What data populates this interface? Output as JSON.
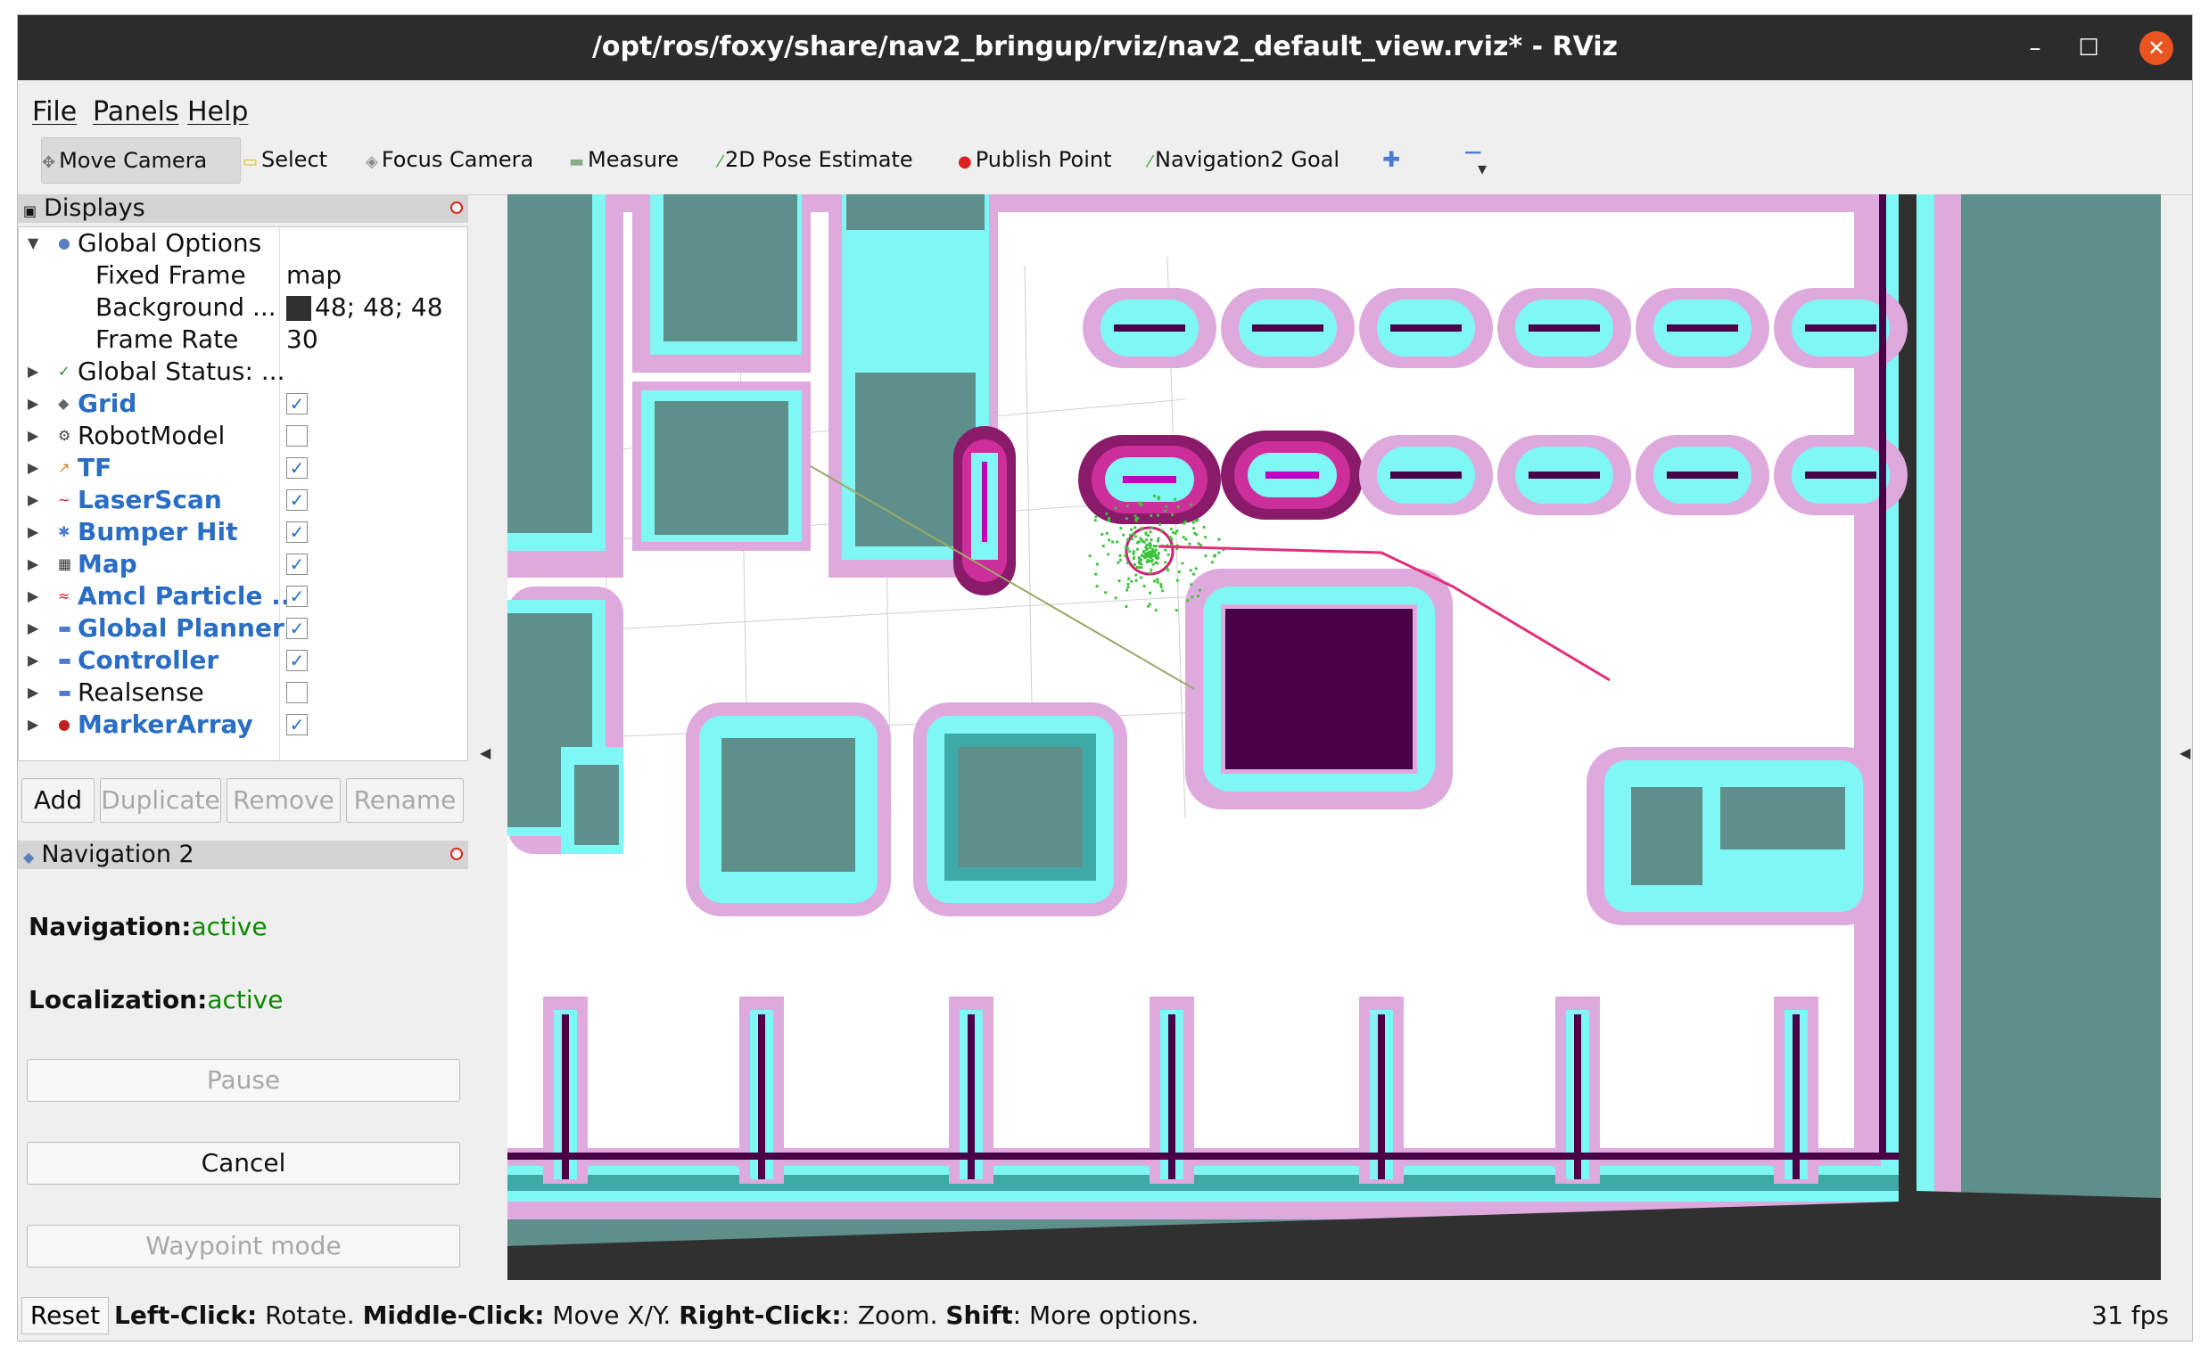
{
  "window": {
    "title": "/opt/ros/foxy/share/nav2_bringup/rviz/nav2_default_view.rviz* - RViz",
    "minimize_glyph": "–",
    "maximize_glyph": "☐",
    "close_glyph": "✕"
  },
  "menubar": {
    "file": "File",
    "panels": "Panels",
    "help": "Help"
  },
  "toolbar": {
    "move_camera": "Move Camera",
    "select": "Select",
    "focus_camera": "Focus Camera",
    "measure": "Measure",
    "pose_estimate": "2D Pose Estimate",
    "publish_point": "Publish Point",
    "nav_goal": "Navigation2 Goal",
    "add_glyph": "✚",
    "remove_glyph": "−",
    "dropdown_glyph": "▾"
  },
  "displays": {
    "header": "Displays",
    "global_options": "Global Options",
    "fixed_frame_label": "Fixed Frame",
    "fixed_frame_value": "map",
    "background_label": "Background ...",
    "background_value": "48; 48; 48",
    "background_color": "#303030",
    "frame_rate_label": "Frame Rate",
    "frame_rate_value": "30",
    "global_status": "Global Status: ...",
    "items": [
      {
        "label": "Grid",
        "checked": true,
        "icon": "grid-icon"
      },
      {
        "label": "RobotModel",
        "checked": false,
        "icon": "robot-model-icon"
      },
      {
        "label": "TF",
        "checked": true,
        "icon": "tf-icon"
      },
      {
        "label": "LaserScan",
        "checked": true,
        "icon": "laser-scan-icon"
      },
      {
        "label": "Bumper Hit",
        "checked": true,
        "icon": "bumper-hit-icon"
      },
      {
        "label": "Map",
        "checked": true,
        "icon": "map-icon"
      },
      {
        "label": "Amcl Particle ...",
        "checked": true,
        "icon": "amcl-particle-icon"
      },
      {
        "label": "Global Planner",
        "checked": true,
        "icon": "folder-icon"
      },
      {
        "label": "Controller",
        "checked": true,
        "icon": "folder-icon"
      },
      {
        "label": "Realsense",
        "checked": false,
        "icon": "folder-icon"
      },
      {
        "label": "MarkerArray",
        "checked": true,
        "icon": "marker-array-icon"
      }
    ],
    "check_glyph": "✓",
    "buttons": {
      "add": "Add",
      "duplicate": "Duplicate",
      "remove": "Remove",
      "rename": "Rename"
    }
  },
  "navigation": {
    "header": "Navigation 2",
    "navigation_label": "Navigation:",
    "navigation_value": "active",
    "localization_label": "Localization:",
    "localization_value": "active",
    "pause": "Pause",
    "cancel": "Cancel",
    "waypoint_mode": "Waypoint mode"
  },
  "statusbar": {
    "reset": "Reset",
    "left_click_key": "Left-Click:",
    "left_click_text": " Rotate. ",
    "middle_click_key": "Middle-Click:",
    "middle_click_text": " Move X/Y. ",
    "right_click_key": "Right-Click:",
    "right_click_text": ": Zoom. ",
    "shift_key": "Shift",
    "shift_text": ": More options.",
    "fps": "31 fps"
  },
  "colors": {
    "map_free": "#ffffff",
    "map_unknown": "#5f8f8b",
    "obstacle": "#4a0047",
    "inflation_cyan": "#7ff7f4",
    "inflation_pink": "#deaade",
    "inflation_teal": "#3fa9a8",
    "plan": "#e0307a",
    "particles": "#3cc43c"
  }
}
